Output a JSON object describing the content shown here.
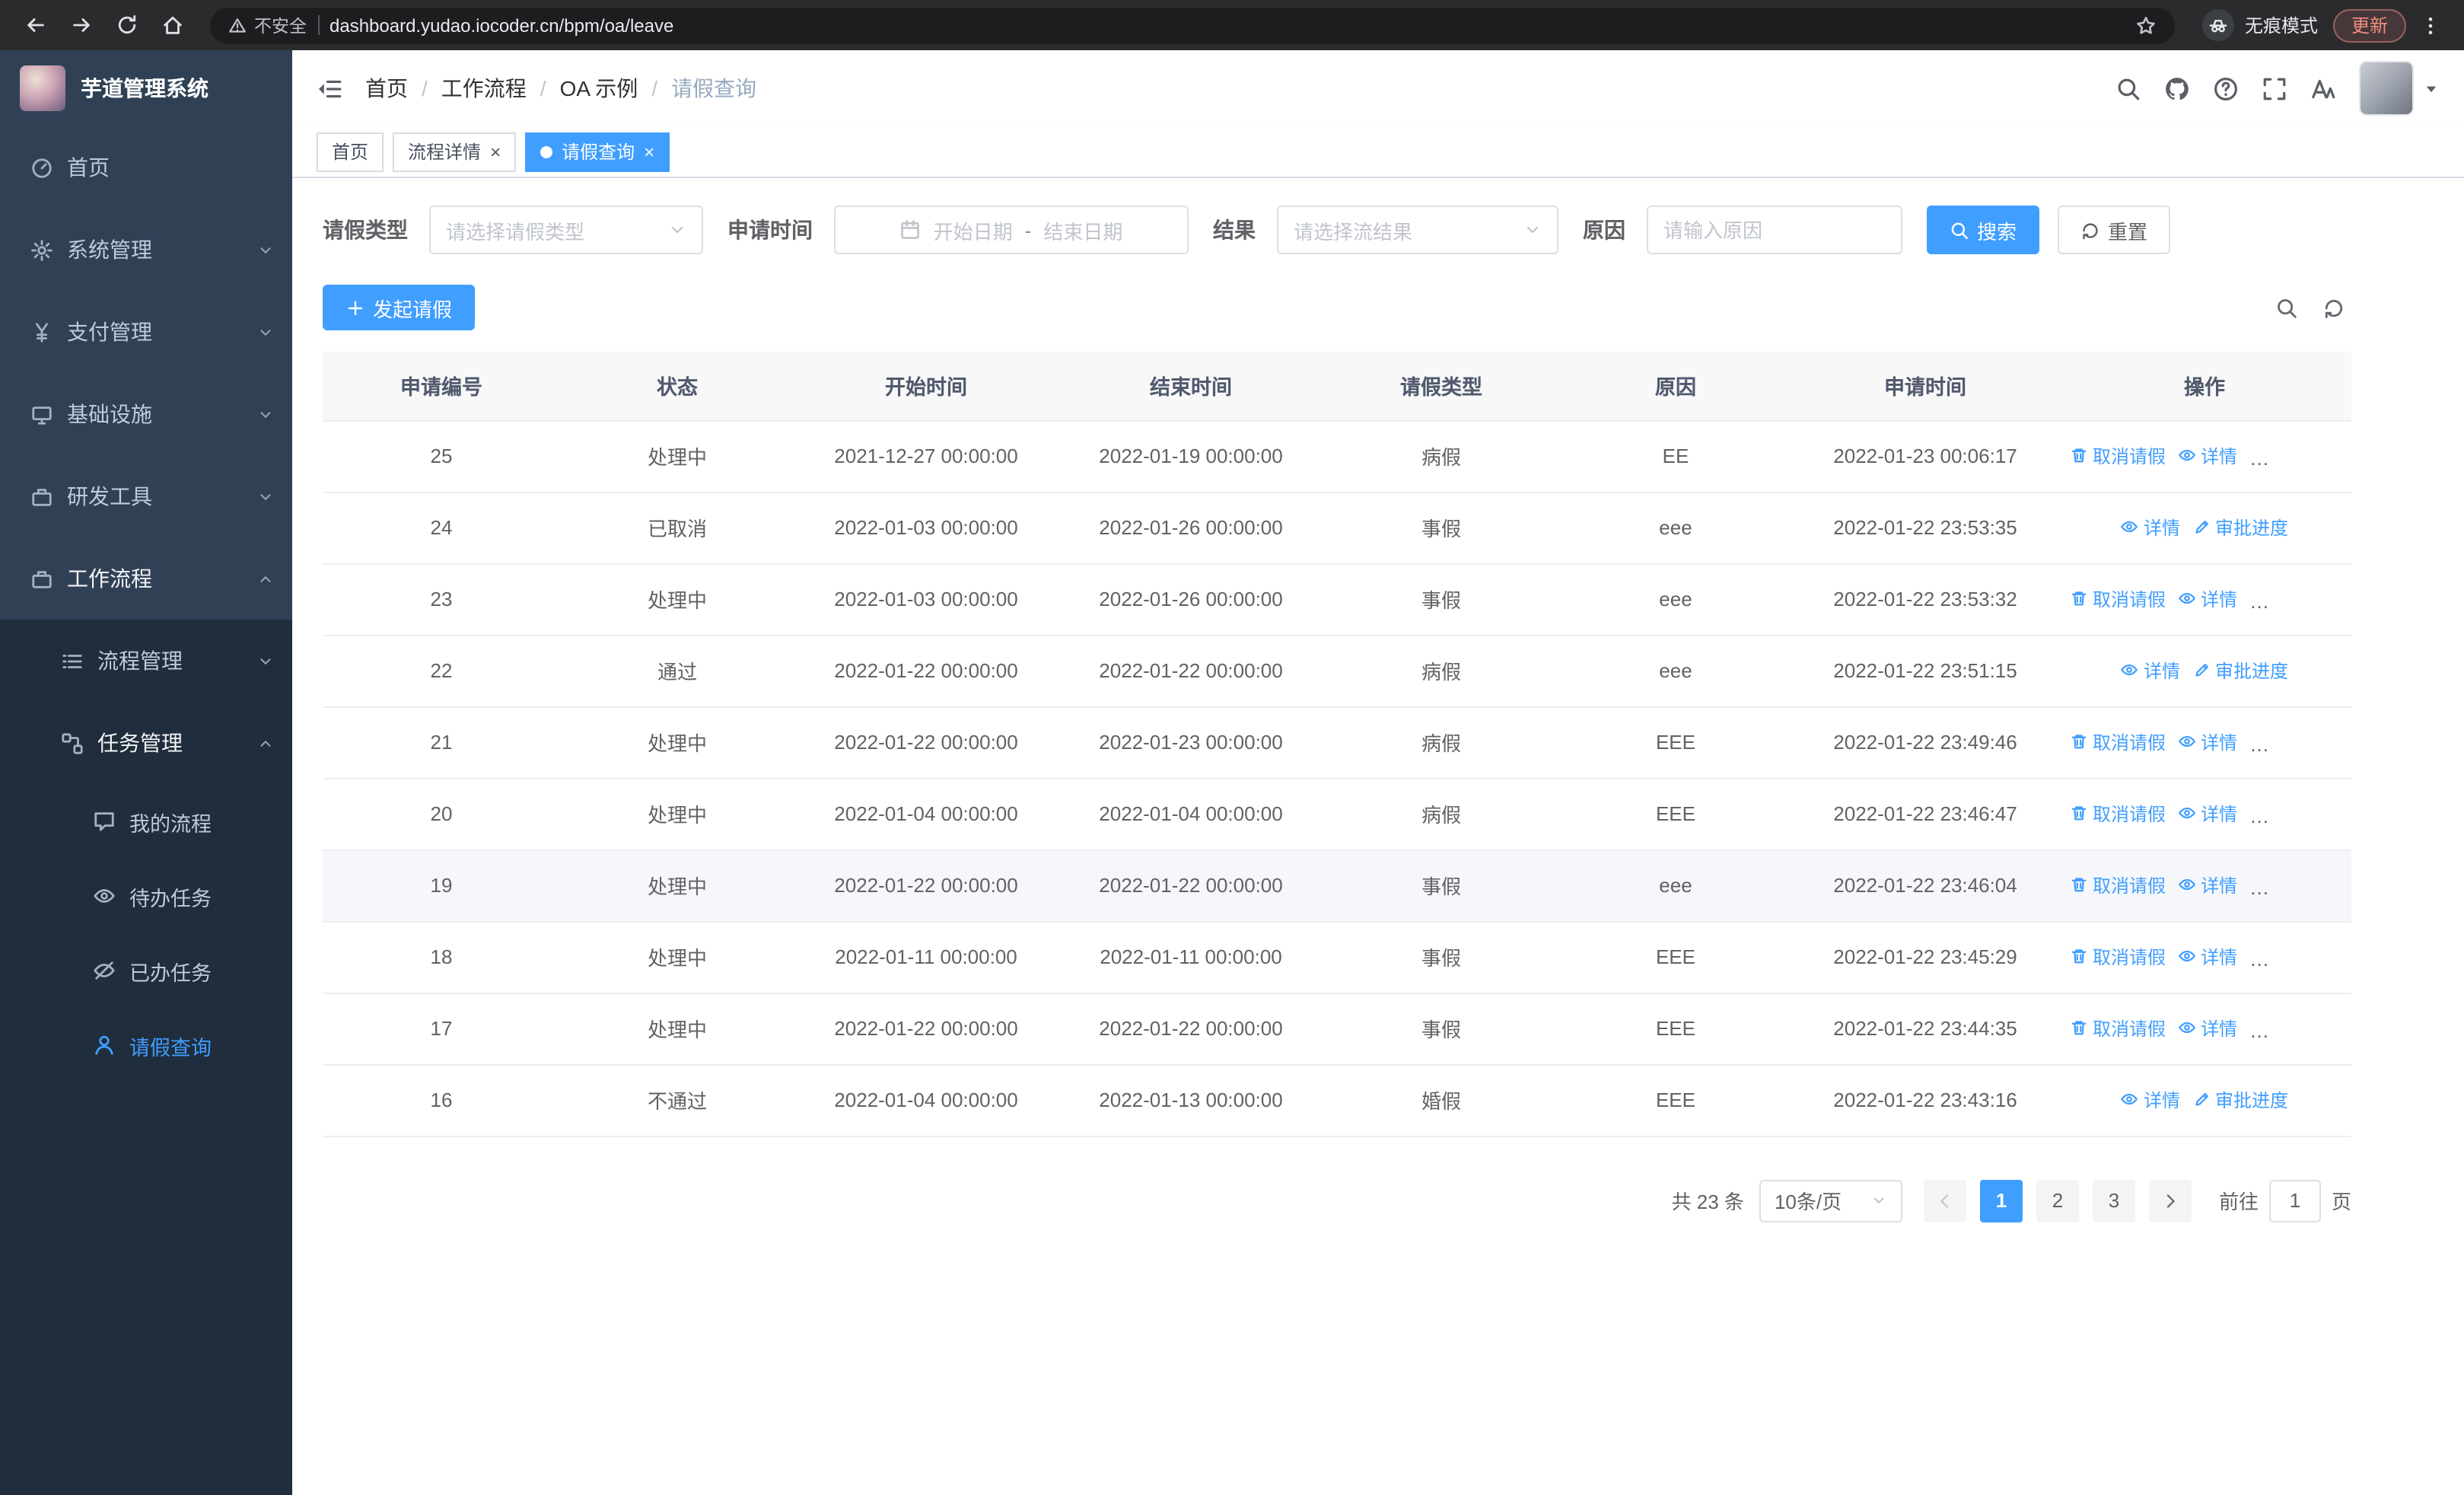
{
  "browser": {
    "nav_icons": [
      "back-icon",
      "forward-icon",
      "reload-icon",
      "home-icon"
    ],
    "security_label": "不安全",
    "url": "dashboard.yudao.iocoder.cn/bpm/oa/leave",
    "incognito_label": "无痕模式",
    "update_label": "更新"
  },
  "sidebar": {
    "logo_title": "芋道管理系统",
    "menu": [
      {
        "label": "首页",
        "icon": "dashboard-icon",
        "level": 1
      },
      {
        "label": "系统管理",
        "icon": "gear-icon",
        "level": 1,
        "expandable": true,
        "expanded": false
      },
      {
        "label": "支付管理",
        "icon": "yen-icon",
        "level": 1,
        "expandable": true,
        "expanded": false
      },
      {
        "label": "基础设施",
        "icon": "monitor-icon",
        "level": 1,
        "expandable": true,
        "expanded": false
      },
      {
        "label": "研发工具",
        "icon": "briefcase-icon",
        "level": 1,
        "expandable": true,
        "expanded": false
      },
      {
        "label": "工作流程",
        "icon": "briefcase-icon",
        "level": 1,
        "expandable": true,
        "expanded": true
      },
      {
        "label": "流程管理",
        "icon": "list-icon",
        "level": 2,
        "expandable": true,
        "expanded": false
      },
      {
        "label": "任务管理",
        "icon": "flow-icon",
        "level": 2,
        "expandable": true,
        "expanded": true
      },
      {
        "label": "我的流程",
        "icon": "chat-icon",
        "level": 3
      },
      {
        "label": "待办任务",
        "icon": "eye-icon",
        "level": 3
      },
      {
        "label": "已办任务",
        "icon": "eye-off-icon",
        "level": 3
      },
      {
        "label": "请假查询",
        "icon": "user-icon",
        "level": 3,
        "active": true
      }
    ]
  },
  "header": {
    "breadcrumb": [
      "首页",
      "工作流程",
      "OA 示例",
      "请假查询"
    ],
    "separator": "/",
    "right_icons": [
      "search-icon",
      "github-icon",
      "help-icon",
      "fullscreen-icon",
      "font-size-icon"
    ]
  },
  "tabs": [
    {
      "label": "首页",
      "closable": false,
      "active": false
    },
    {
      "label": "流程详情",
      "closable": true,
      "active": false
    },
    {
      "label": "请假查询",
      "closable": true,
      "active": true
    }
  ],
  "filters": {
    "leave_type_label": "请假类型",
    "leave_type_placeholder": "请选择请假类型",
    "apply_time_label": "申请时间",
    "date_start_placeholder": "开始日期",
    "date_separator": "-",
    "date_end_placeholder": "结束日期",
    "result_label": "结果",
    "result_placeholder": "请选择流结果",
    "reason_label": "原因",
    "reason_placeholder": "请输入原因",
    "search_label": "搜索",
    "reset_label": "重置"
  },
  "toolbar": {
    "create_label": "发起请假",
    "right_icons": [
      "search-icon",
      "refresh-icon"
    ]
  },
  "table": {
    "columns": [
      "申请编号",
      "状态",
      "开始时间",
      "结束时间",
      "请假类型",
      "原因",
      "申请时间",
      "操作"
    ],
    "action_labels": {
      "cancel": "取消请假",
      "detail": "详情",
      "progress": "审批进度"
    },
    "rows": [
      {
        "id": "25",
        "status": "处理中",
        "start": "2021-12-27 00:00:00",
        "end": "2022-01-19 00:00:00",
        "type": "病假",
        "reason": "EE",
        "apply": "2022-01-23 00:06:17",
        "cancellable": true
      },
      {
        "id": "24",
        "status": "已取消",
        "start": "2022-01-03 00:00:00",
        "end": "2022-01-26 00:00:00",
        "type": "事假",
        "reason": "eee",
        "apply": "2022-01-22 23:53:35",
        "cancellable": false
      },
      {
        "id": "23",
        "status": "处理中",
        "start": "2022-01-03 00:00:00",
        "end": "2022-01-26 00:00:00",
        "type": "事假",
        "reason": "eee",
        "apply": "2022-01-22 23:53:32",
        "cancellable": true
      },
      {
        "id": "22",
        "status": "通过",
        "start": "2022-01-22 00:00:00",
        "end": "2022-01-22 00:00:00",
        "type": "病假",
        "reason": "eee",
        "apply": "2022-01-22 23:51:15",
        "cancellable": false
      },
      {
        "id": "21",
        "status": "处理中",
        "start": "2022-01-22 00:00:00",
        "end": "2022-01-23 00:00:00",
        "type": "病假",
        "reason": "EEE",
        "apply": "2022-01-22 23:49:46",
        "cancellable": true
      },
      {
        "id": "20",
        "status": "处理中",
        "start": "2022-01-04 00:00:00",
        "end": "2022-01-04 00:00:00",
        "type": "病假",
        "reason": "EEE",
        "apply": "2022-01-22 23:46:47",
        "cancellable": true
      },
      {
        "id": "19",
        "status": "处理中",
        "start": "2022-01-22 00:00:00",
        "end": "2022-01-22 00:00:00",
        "type": "事假",
        "reason": "eee",
        "apply": "2022-01-22 23:46:04",
        "cancellable": true,
        "highlighted": true
      },
      {
        "id": "18",
        "status": "处理中",
        "start": "2022-01-11 00:00:00",
        "end": "2022-01-11 00:00:00",
        "type": "事假",
        "reason": "EEE",
        "apply": "2022-01-22 23:45:29",
        "cancellable": true
      },
      {
        "id": "17",
        "status": "处理中",
        "start": "2022-01-22 00:00:00",
        "end": "2022-01-22 00:00:00",
        "type": "事假",
        "reason": "EEE",
        "apply": "2022-01-22 23:44:35",
        "cancellable": true
      },
      {
        "id": "16",
        "status": "不通过",
        "start": "2022-01-04 00:00:00",
        "end": "2022-01-13 00:00:00",
        "type": "婚假",
        "reason": "EEE",
        "apply": "2022-01-22 23:43:16",
        "cancellable": false
      }
    ]
  },
  "pagination": {
    "total_label": "共 23 条",
    "page_size_label": "10条/页",
    "pages": [
      "1",
      "2",
      "3"
    ],
    "active_page": "1",
    "goto_label": "前往",
    "goto_value": "1",
    "goto_suffix": "页"
  }
}
